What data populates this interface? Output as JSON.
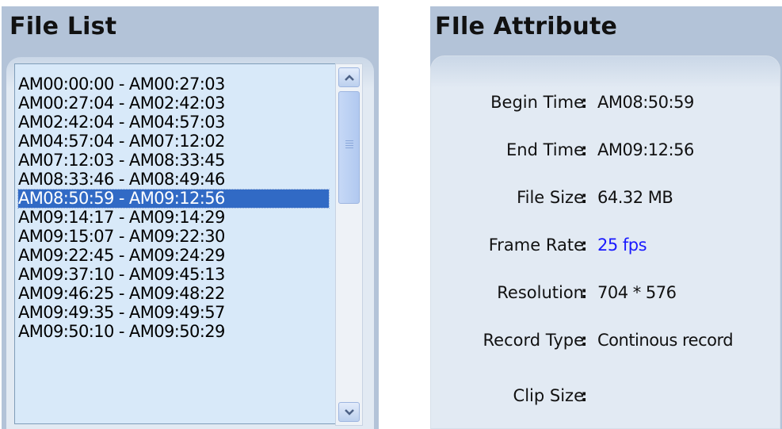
{
  "file_list": {
    "title": "File List",
    "items": [
      "AM00:00:00 - AM00:27:03",
      "AM00:27:04 - AM02:42:03",
      "AM02:42:04 - AM04:57:03",
      "AM04:57:04 - AM07:12:02",
      "AM07:12:03 - AM08:33:45",
      "AM08:33:46 - AM08:49:46",
      "AM08:50:59 - AM09:12:56",
      "AM09:14:17 - AM09:14:29",
      "AM09:15:07 - AM09:22:30",
      "AM09:22:45 - AM09:24:29",
      "AM09:37:10 - AM09:45:13",
      "AM09:46:25 - AM09:48:22",
      "AM09:49:35 - AM09:49:57",
      "AM09:50:10 - AM09:50:29"
    ],
    "selected_index": 6
  },
  "file_attribute": {
    "title": "FIle Attribute",
    "rows": [
      {
        "label": "Begin Time",
        "value": "AM08:50:59"
      },
      {
        "label": "End Time",
        "value": "AM09:12:56"
      },
      {
        "label": "File Size",
        "value": "64.32 MB"
      },
      {
        "label": "Frame Rate",
        "value": "25 fps"
      },
      {
        "label": "Resolution",
        "value": "704 * 576"
      },
      {
        "label": "Record Type",
        "value": "Continous record"
      },
      {
        "label": "Clip Size",
        "value": ""
      }
    ],
    "colon": ":",
    "link_color": "#1a1aff"
  },
  "colors": {
    "panel_bg": "#b3c3d8",
    "list_bg": "#d8e9f9",
    "selection": "#316ac5"
  }
}
